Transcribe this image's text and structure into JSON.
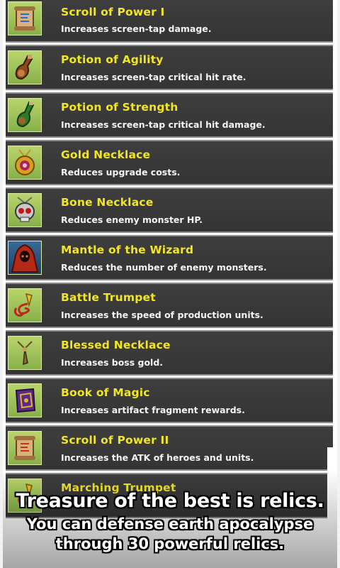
{
  "relics": [
    {
      "name": "Scroll of Power I",
      "desc": "Increases screen-tap damage.",
      "icon": "scroll-icon"
    },
    {
      "name": "Potion of Agility",
      "desc": "Increases screen-tap critical hit rate.",
      "icon": "potion-icon"
    },
    {
      "name": "Potion of Strength",
      "desc": "Increases screen-tap critical hit damage.",
      "icon": "potion-bottle-icon"
    },
    {
      "name": "Gold Necklace",
      "desc": "Reduces upgrade costs.",
      "icon": "gold-necklace-icon"
    },
    {
      "name": "Bone Necklace",
      "desc": "Reduces enemy monster HP.",
      "icon": "skull-necklace-icon"
    },
    {
      "name": "Mantle of the Wizard",
      "desc": "Reduces the number of enemy monsters.",
      "icon": "wizard-mantle-icon"
    },
    {
      "name": "Battle Trumpet",
      "desc": "Increases the speed of production units.",
      "icon": "trumpet-icon"
    },
    {
      "name": "Blessed Necklace",
      "desc": "Increases boss gold.",
      "icon": "blessed-necklace-icon"
    },
    {
      "name": "Book of Magic",
      "desc": "Increases artifact fragment rewards.",
      "icon": "magic-book-icon"
    },
    {
      "name": "Scroll of Power II",
      "desc": "Increases the ATK of heroes and units.",
      "icon": "scroll-icon"
    },
    {
      "name": "Marching Trumpet",
      "desc": "",
      "icon": "trumpet-icon"
    }
  ],
  "caption": {
    "line1": "Treasure of the best is relics.",
    "line2": "You can defense earth apocalypse",
    "line3": "through 30 powerful relics."
  },
  "colors": {
    "row_bg": "#3a3a3a",
    "name": "#f2e624",
    "desc": "#f4f4f4",
    "icon_bg": "#9cc25a"
  }
}
